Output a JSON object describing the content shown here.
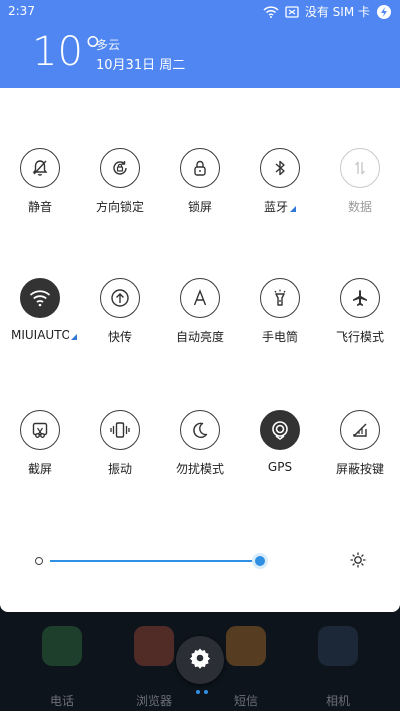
{
  "status_bar": {
    "time": "2:37",
    "sim_status": "没有 SIM 卡",
    "icons": [
      "wifi-icon",
      "sim-icon",
      "battery-charging-icon"
    ]
  },
  "weather": {
    "temperature": "10°",
    "condition": "多云",
    "date": "10月31日 周二"
  },
  "quick_settings": {
    "rows": [
      [
        {
          "label": "静音",
          "icon": "bell-mute-icon",
          "state": "off"
        },
        {
          "label": "方向锁定",
          "icon": "rotation-lock-icon",
          "state": "off"
        },
        {
          "label": "锁屏",
          "icon": "lock-icon",
          "state": "off"
        },
        {
          "label": "蓝牙",
          "icon": "bluetooth-icon",
          "state": "off",
          "expandable": true
        },
        {
          "label": "数据",
          "icon": "mobile-data-icon",
          "state": "disabled"
        }
      ],
      [
        {
          "label": "MIUIAUTO",
          "icon": "wifi-icon",
          "state": "on",
          "expandable": true
        },
        {
          "label": "快传",
          "icon": "transfer-icon",
          "state": "off"
        },
        {
          "label": "自动亮度",
          "icon": "auto-brightness-icon",
          "state": "off"
        },
        {
          "label": "手电筒",
          "icon": "flashlight-icon",
          "state": "off"
        },
        {
          "label": "飞行模式",
          "icon": "airplane-icon",
          "state": "off"
        }
      ],
      [
        {
          "label": "截屏",
          "icon": "screenshot-icon",
          "state": "off"
        },
        {
          "label": "振动",
          "icon": "vibrate-icon",
          "state": "off"
        },
        {
          "label": "勿扰模式",
          "icon": "moon-icon",
          "state": "off"
        },
        {
          "label": "GPS",
          "icon": "gps-icon",
          "state": "on"
        },
        {
          "label": "屏蔽按键",
          "icon": "block-keys-icon",
          "state": "off"
        }
      ]
    ]
  },
  "brightness": {
    "level_percent": 97
  },
  "home_dock": {
    "apps": [
      "电话",
      "浏览器",
      "短信",
      "相机"
    ]
  },
  "colors": {
    "header": "#4f86f2",
    "accent": "#2f8fe2",
    "active_tile": "#333333"
  }
}
